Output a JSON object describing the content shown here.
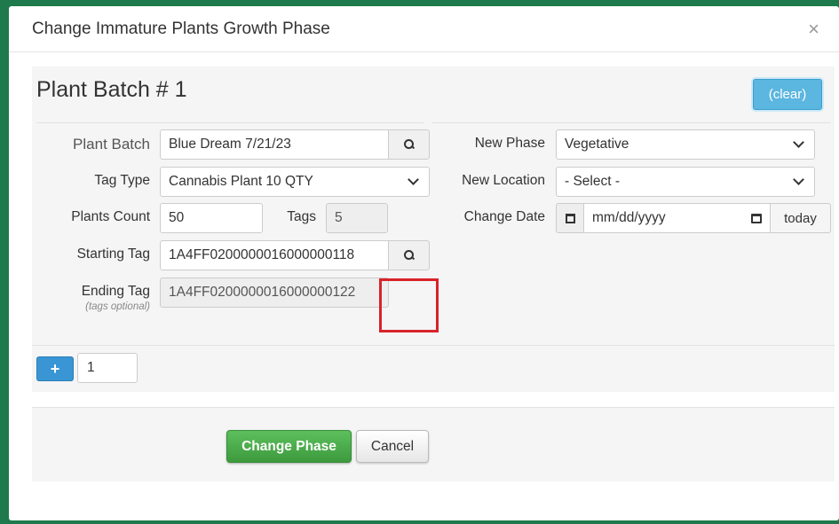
{
  "modal": {
    "title": "Change Immature Plants Growth Phase",
    "close_label": "×"
  },
  "batch": {
    "title": "Plant Batch # 1",
    "clear_label": "(clear)",
    "plant_batch": {
      "label": "Plant Batch",
      "value": "Blue Dream 7/21/23"
    },
    "tag_type": {
      "label": "Tag Type",
      "value": "Cannabis Plant 10 QTY"
    },
    "plants_count": {
      "label": "Plants Count",
      "value": "50"
    },
    "tags": {
      "label": "Tags",
      "value": "5"
    },
    "starting_tag": {
      "label": "Starting Tag",
      "value": "1A4FF0200000016000000118"
    },
    "ending_tag": {
      "label": "Ending Tag",
      "sublabel": "(tags optional)",
      "value": "1A4FF0200000016000000122"
    },
    "new_phase": {
      "label": "New Phase",
      "value": "Vegetative"
    },
    "new_location": {
      "label": "New Location",
      "value": "- Select -"
    },
    "change_date": {
      "label": "Change Date",
      "placeholder": "mm/dd/yyyy",
      "today_label": "today"
    }
  },
  "add_row": {
    "plus_label": "+",
    "count": "1"
  },
  "footer": {
    "change_phase_label": "Change Phase",
    "cancel_label": "Cancel"
  },
  "colors": {
    "accent_green": "#4cae4c",
    "info_blue": "#5bb6e0",
    "highlight_red": "#d9232a"
  }
}
